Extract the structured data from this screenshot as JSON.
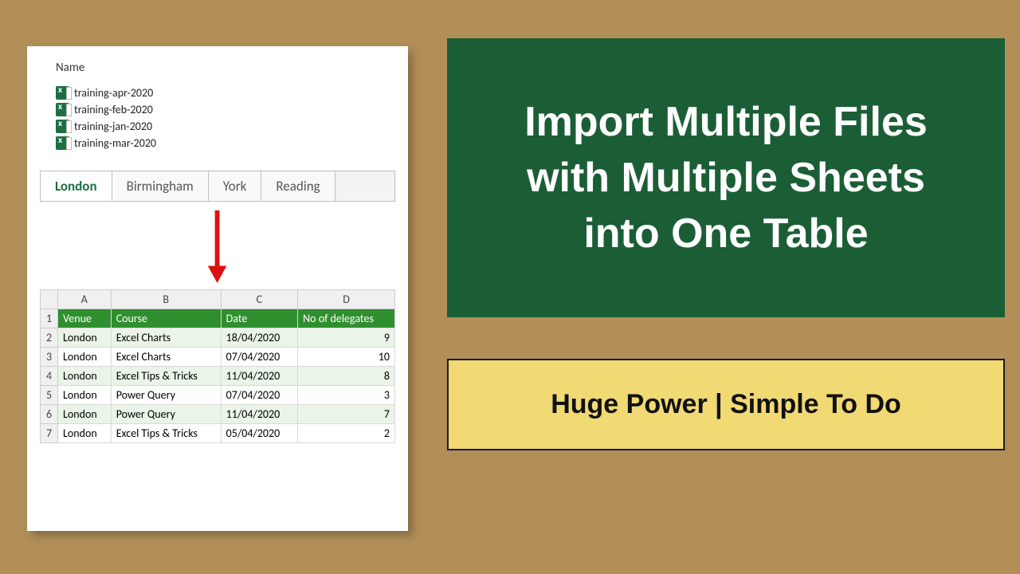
{
  "titleBox": {
    "line1": "Import Multiple Files",
    "line2": "with Multiple Sheets",
    "line3": "into One Table"
  },
  "subBox": "Huge Power | Simple To Do",
  "fileList": {
    "header": "Name",
    "items": [
      "training-apr-2020",
      "training-feb-2020",
      "training-jan-2020",
      "training-mar-2020"
    ]
  },
  "tabs": [
    "London",
    "Birmingham",
    "York",
    "Reading"
  ],
  "activeTab": 0,
  "sheet": {
    "colHeaders": [
      "A",
      "B",
      "C",
      "D"
    ],
    "headerRow": [
      "Venue",
      "Course",
      "Date",
      "No of delegates"
    ],
    "rows": [
      [
        "London",
        "Excel Charts",
        "18/04/2020",
        "9"
      ],
      [
        "London",
        "Excel Charts",
        "07/04/2020",
        "10"
      ],
      [
        "London",
        "Excel Tips & Tricks",
        "11/04/2020",
        "8"
      ],
      [
        "London",
        "Power Query",
        "07/04/2020",
        "3"
      ],
      [
        "London",
        "Power Query",
        "11/04/2020",
        "7"
      ],
      [
        "London",
        "Excel Tips & Tricks",
        "05/04/2020",
        "2"
      ]
    ]
  }
}
